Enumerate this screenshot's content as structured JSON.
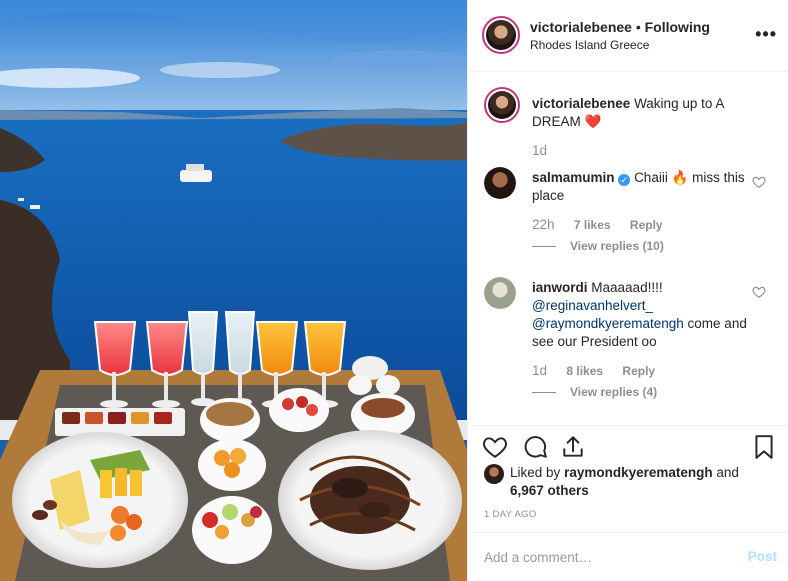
{
  "post": {
    "username": "victorialebenee",
    "separator": " • ",
    "follow_status": "Following",
    "location": "Rhodes Island Greece",
    "more_label": "•••"
  },
  "caption": {
    "username": "victorialebenee",
    "text": "Waking up to A DREAM",
    "emoji": "❤️",
    "time": "1d"
  },
  "comments": [
    {
      "username": "salmamumin",
      "text_pre": "Chaiii",
      "emoji": "🔥",
      "text_post": "miss this place",
      "time": "22h",
      "likes": "7 likes",
      "reply": "Reply",
      "view_replies": "View replies (10)"
    },
    {
      "username": "ianwordi",
      "text_pre": "Maaaaad!!!!",
      "mention1": "@reginavanhelvert_",
      "mention2": "@raymondkyerematengh",
      "text_post": "come and see our President oo",
      "time": "1d",
      "likes": "8 likes",
      "reply": "Reply",
      "view_replies": "View replies (4)"
    }
  ],
  "likes": {
    "prefix": "Liked by",
    "user": "raymondkyerematengh",
    "and": "and",
    "others": "6,967 others"
  },
  "time_ago": "1 DAY AGO",
  "add_comment": {
    "placeholder": "Add a comment…",
    "post_label": "Post"
  },
  "colors": {
    "accent_blue": "#3897f0",
    "post_button_disabled": "#b2dffc",
    "muted": "#8e8e8e",
    "heart_red": "#ed4956"
  }
}
